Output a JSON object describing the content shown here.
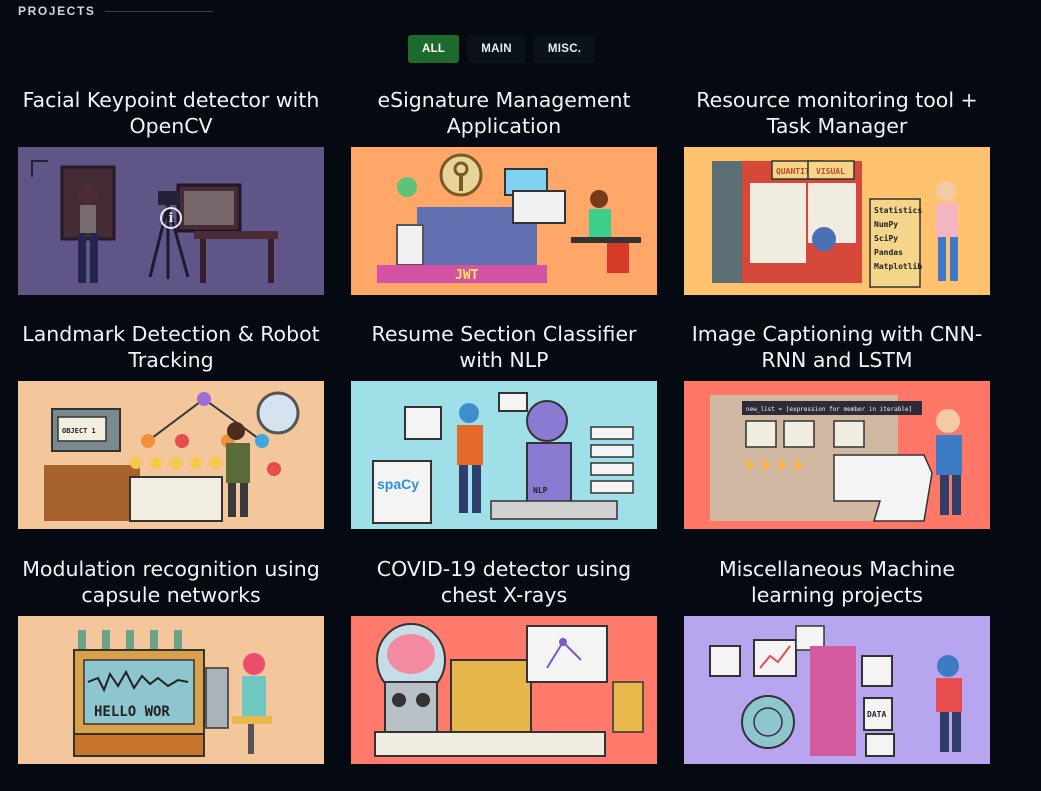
{
  "section": {
    "title": "PROJECTS"
  },
  "filters": [
    {
      "label": "ALL",
      "active": true
    },
    {
      "label": "MAIN",
      "active": false
    },
    {
      "label": "MISC.",
      "active": false
    }
  ],
  "projects": [
    {
      "title": "Facial Keypoint detector with OpenCV",
      "bg": "#b3a5e0"
    },
    {
      "title": "eSignature Management Application",
      "bg": "#ffa768"
    },
    {
      "title": "Resource monitoring tool + Task Manager",
      "bg": "#ffc36f"
    },
    {
      "title": "Landmark Detection & Robot Tracking",
      "bg": "#f3c69c"
    },
    {
      "title": "Resume Section Classifier with NLP",
      "bg": "#9fe0e8"
    },
    {
      "title": "Image Captioning with CNN-RNN and LSTM",
      "bg": "#ff7766"
    },
    {
      "title": "Modulation recognition using capsule networks",
      "bg": "#f3c69c"
    },
    {
      "title": "COVID-19 detector using chest X-rays",
      "bg": "#ff7a6b"
    },
    {
      "title": "Miscellaneous Machine learning projects",
      "bg": "#b7a6ef"
    }
  ],
  "art": {
    "jwt_label": "JWT",
    "quantity_label": "QUANTITY",
    "visual_label": "VISUAL",
    "libs": [
      "Statistics",
      "NumPy",
      "SciPy",
      "Pandas",
      "Matplotlib"
    ],
    "spacy_label": "spaCy",
    "nlp_label": "NLP",
    "hello_label": "HELLO WOR",
    "data_label": "DATA",
    "code_label": "new_list = [expression for member in iterable]",
    "object_label": "OBJECT 1"
  }
}
